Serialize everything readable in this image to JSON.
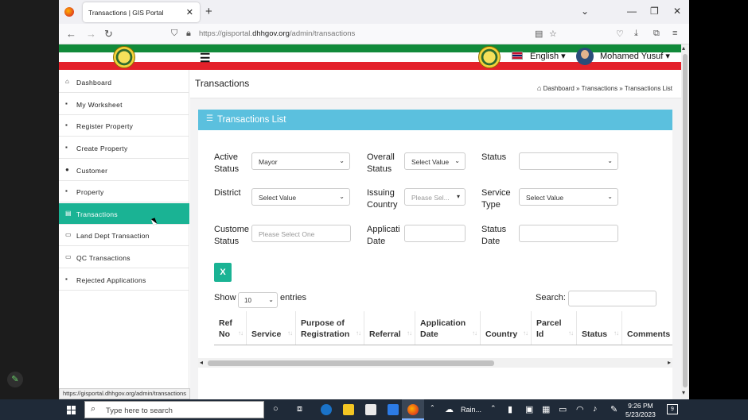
{
  "browser": {
    "tab_title": "Transactions | GIS Portal",
    "url_prefix": "https://gisportal.",
    "url_domain": "dhhgov.org",
    "url_path": "/admin/transactions",
    "status_url": "https://gisportal.dhhgov.org/admin/transactions"
  },
  "header": {
    "language": "English",
    "user_name": "Mohamed Yusuf"
  },
  "sidebar": {
    "items": [
      {
        "label": "Dashboard"
      },
      {
        "label": "My Worksheet"
      },
      {
        "label": "Register Property"
      },
      {
        "label": "Create Property"
      },
      {
        "label": "Customer"
      },
      {
        "label": "Property"
      },
      {
        "label": "Transactions",
        "active": true
      },
      {
        "label": "Land Dept Transaction"
      },
      {
        "label": "QC Transactions"
      },
      {
        "label": "Rejected Applications"
      }
    ]
  },
  "main": {
    "page_title": "Transactions",
    "breadcrumb": [
      "Dashboard",
      "Transactions",
      "Transactions List"
    ],
    "panel_title": "Transactions List"
  },
  "filters": {
    "active_status_label1": "Active",
    "active_status_label2": "Status",
    "active_status_value": "Mayor",
    "overall_status_label1": "Overall",
    "overall_status_label2": "Status",
    "overall_status_value": "Select Value",
    "status_label": "Status",
    "status_value": "",
    "district_label": "District",
    "district_value": "Select Value",
    "issuing_country_label1": "Issuing",
    "issuing_country_label2": "Country",
    "issuing_country_value": "Please Sel...",
    "service_type_label1": "Service",
    "service_type_label2": "Type",
    "service_type_value": "Select Value",
    "customer_status_label1": "Custome",
    "customer_status_label2": "Status",
    "customer_status_placeholder": "Please Select One",
    "application_date_label1": "Applicati",
    "application_date_label2": "Date",
    "status_date_label1": "Status",
    "status_date_label2": "Date"
  },
  "table": {
    "show_label": "Show",
    "entries_value": "10",
    "entries_label": "entries",
    "search_label": "Search:",
    "columns": [
      {
        "line1": "Ref",
        "line2": "No"
      },
      {
        "line1": "",
        "line2": "Service"
      },
      {
        "line1": "Purpose of",
        "line2": "Registration"
      },
      {
        "line1": "",
        "line2": "Referral"
      },
      {
        "line1": "Application",
        "line2": "Date"
      },
      {
        "line1": "",
        "line2": "Country"
      },
      {
        "line1": "Parcel",
        "line2": "Id"
      },
      {
        "line1": "",
        "line2": "Status"
      },
      {
        "line1": "",
        "line2": "Comments"
      }
    ]
  },
  "taskbar": {
    "search_placeholder": "Type here to search",
    "weather": "Rain...",
    "time": "9:26 PM",
    "date": "5/23/2023",
    "notifications": "9"
  },
  "colors": {
    "accent_green": "#1ab394",
    "panel_blue": "#5bc0de",
    "flag_green": "#118a3a",
    "flag_red": "#e4212a"
  }
}
